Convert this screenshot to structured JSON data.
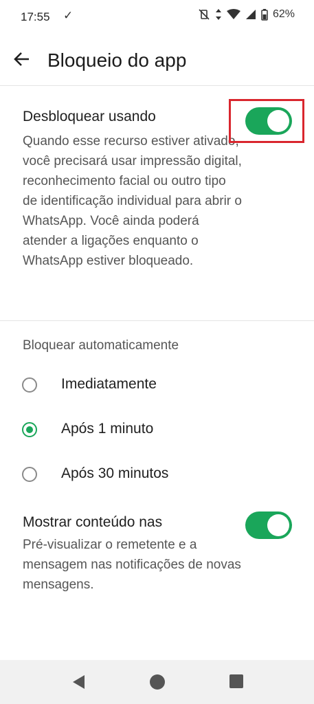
{
  "status_bar": {
    "time": "17:55",
    "check_glyph": "✓",
    "battery": "62%"
  },
  "header": {
    "title": "Bloqueio do app"
  },
  "unlock_section": {
    "title": "Desbloquear usando",
    "description": "Quando esse recurso estiver ativado, você precisará usar impressão digital, reconhecimento facial ou outro tipo de identificação individual para abrir o WhatsApp. Você ainda poderá atender a ligações enquanto o WhatsApp estiver bloqueado.",
    "toggle_on": true
  },
  "auto_lock": {
    "label": "Bloquear automaticamente",
    "options": [
      {
        "label": "Imediatamente",
        "selected": false
      },
      {
        "label": "Após 1 minuto",
        "selected": true
      },
      {
        "label": "Após 30 minutos",
        "selected": false
      }
    ]
  },
  "notifications_section": {
    "title": "Mostrar conteúdo nas",
    "description": "Pré-visualizar o remetente e a mensagem nas notificações de novas mensagens.",
    "toggle_on": true
  },
  "colors": {
    "accent": "#1aa65a",
    "highlight": "#d9262e"
  },
  "icons": {
    "back": "arrow-left-icon",
    "nav_back": "triangle-back-icon",
    "nav_home": "circle-home-icon",
    "nav_recents": "square-recents-icon"
  }
}
